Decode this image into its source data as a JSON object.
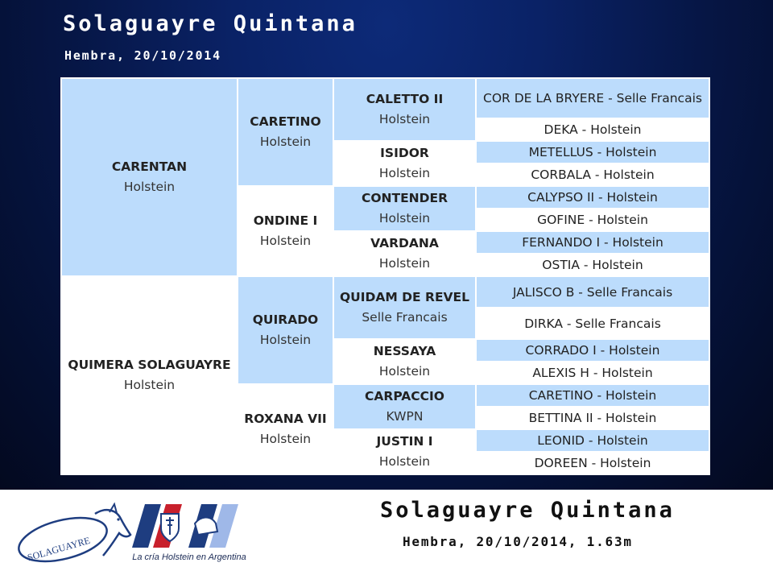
{
  "header": {
    "title": "Solaguayre Quintana",
    "subtitle": "Hembra, 20/10/2014"
  },
  "pedigree": {
    "sire": {
      "name": "CARENTAN",
      "breed": "Holstein"
    },
    "dam": {
      "name": "QUIMERA SOLAGUAYRE",
      "breed": "Holstein"
    },
    "g2": [
      {
        "name": "CARETINO",
        "breed": "Holstein"
      },
      {
        "name": "ONDINE I",
        "breed": "Holstein"
      },
      {
        "name": "QUIRADO",
        "breed": "Holstein"
      },
      {
        "name": "ROXANA VII",
        "breed": "Holstein"
      }
    ],
    "g3": [
      {
        "name": "CALETTO II",
        "breed": "Holstein"
      },
      {
        "name": "ISIDOR",
        "breed": "Holstein"
      },
      {
        "name": "CONTENDER",
        "breed": "Holstein"
      },
      {
        "name": "VARDANA",
        "breed": "Holstein"
      },
      {
        "name": "QUIDAM DE REVEL",
        "breed": "Selle Francais"
      },
      {
        "name": "NESSAYA",
        "breed": "Holstein"
      },
      {
        "name": "CARPACCIO",
        "breed": "KWPN"
      },
      {
        "name": "JUSTIN I",
        "breed": "Holstein"
      }
    ],
    "g4": [
      "COR DE LA BRYERE - Selle Francais",
      "DEKA - Holstein",
      "METELLUS - Holstein",
      "CORBALA - Holstein",
      "CALYPSO II - Holstein",
      "GOFINE - Holstein",
      "FERNANDO I - Holstein",
      "OSTIA - Holstein",
      "JALISCO B - Selle Francais",
      "DIRKA - Selle Francais",
      "CORRADO I - Holstein",
      "ALEXIS H - Holstein",
      "CARETINO - Holstein",
      "BETTINA II - Holstein",
      "LEONID - Holstein",
      "DOREEN - Holstein"
    ]
  },
  "footer": {
    "title": "Solaguayre Quintana",
    "subtitle": "Hembra, 20/10/2014, 1.63m",
    "logo_text": "SOLAGUAYRE",
    "tagline": "La cría Holstein en Argentina"
  },
  "colors": {
    "background": "#0a2266",
    "sire_cell": "#bcdcfc",
    "dam_cell": "#ffffff"
  }
}
